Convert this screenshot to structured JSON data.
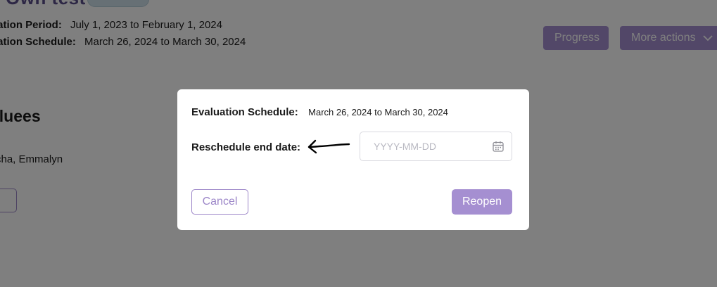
{
  "background": {
    "evaluation_period": {
      "label": "uation Period:",
      "value": "July 1, 2023 to February 1, 2024"
    },
    "evaluation_schedule": {
      "label": "uation Schedule:",
      "value": "March 26, 2024 to March 30, 2024"
    },
    "buttons": {
      "progress": "Progress",
      "more_actions": "More actions"
    },
    "evaluees_heading": "aluees",
    "evaluee_name": "cha, Emmalyn"
  },
  "modal": {
    "schedule_label": "Evaluation Schedule:",
    "schedule_value": "March 26, 2024 to March 30, 2024",
    "reschedule_label": "Reschedule end date:",
    "date_input": {
      "placeholder": "YYYY-MM-DD",
      "value": ""
    },
    "cancel_label": "Cancel",
    "reopen_label": "Reopen"
  },
  "colors": {
    "accent": "#a58fd1",
    "accent_border": "#9c86c8",
    "overlay": "rgba(0,0,0,0.5)"
  },
  "icons": {
    "calendar": "calendar-icon",
    "chevron": "chevron-down-icon",
    "annotation_arrow": "hand-drawn-arrow-icon"
  }
}
